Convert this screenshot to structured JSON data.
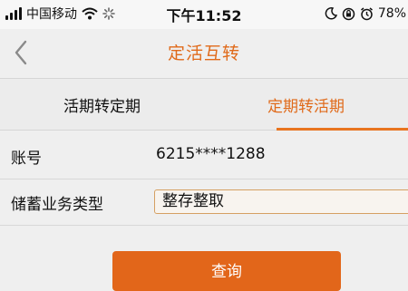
{
  "status_bar": {
    "carrier": "中国移动",
    "time": "下午11:52",
    "battery": "78%",
    "icons": [
      "signal-icon",
      "wifi-icon",
      "loading-icon",
      "moon-icon",
      "rotation-lock-icon",
      "alarm-icon",
      "battery-icon"
    ]
  },
  "nav": {
    "title": "定活互转",
    "back_icon": "chevron-left-icon"
  },
  "tabs": [
    {
      "label": "活期转定期",
      "active": false
    },
    {
      "label": "定期转活期",
      "active": true
    }
  ],
  "form": {
    "account": {
      "label": "账号",
      "value": "6215****1288"
    },
    "savings_type": {
      "label": "储蓄业务类型",
      "value": "整存整取"
    }
  },
  "query_button": {
    "label": "查询"
  },
  "colors": {
    "accent": "#e06a1a",
    "button": "#e2661a",
    "background": "#efefef",
    "select_border": "#d5a062"
  }
}
